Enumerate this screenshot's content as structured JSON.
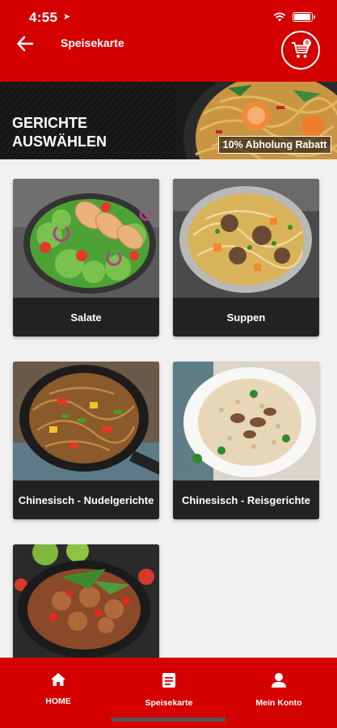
{
  "status_bar": {
    "time": "4:55",
    "location_glyph": "➤"
  },
  "header": {
    "title": "Speisekarte",
    "cart_count": "0"
  },
  "banner": {
    "line1": "GERICHTE",
    "line2": "AUSWÄHLEN",
    "promo": "10% Abholung Rabatt"
  },
  "categories": [
    {
      "label": "Salate"
    },
    {
      "label": "Suppen"
    },
    {
      "label": "Chinesisch - Nudelgerichte"
    },
    {
      "label": "Chinesisch - Reisgerichte"
    },
    {
      "label": ""
    }
  ],
  "bottom_nav": {
    "home": "HOME",
    "menu": "Speisekarte",
    "account": "Mein Konto"
  },
  "colors": {
    "brand_red": "#d40000",
    "card_dark": "#222222"
  }
}
